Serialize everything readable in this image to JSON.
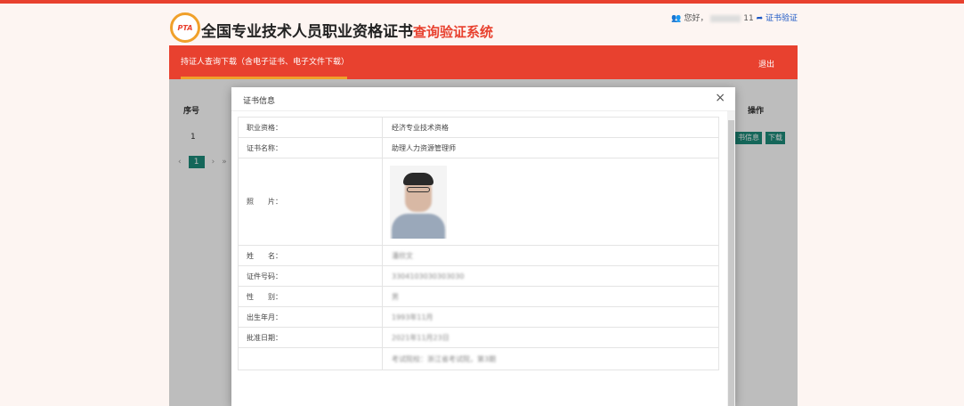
{
  "header": {
    "title_main": "全国专业技术人员职业资格证书",
    "title_sub": "查询验证系统",
    "logo_text": "PTA",
    "greeting": "您好，",
    "user_suffix": "11",
    "verify_link": "证书验证"
  },
  "nav": {
    "tab": "持证人查询下载（含电子证书、电子文件下载）",
    "logout": "退出"
  },
  "table": {
    "col_index": "序号",
    "col_op": "操作",
    "row_index": "1",
    "btn_info": "书信息",
    "btn_download": "下载"
  },
  "pager": {
    "prev": "‹",
    "page": "1",
    "next": "›",
    "last": "»"
  },
  "modal": {
    "title": "证书信息",
    "close": "×",
    "rows": {
      "qual_label": "职业资格：",
      "qual_value": "经济专业技术资格",
      "cert_name_label": "证书名称：",
      "cert_name_value": "助理人力资源管理师",
      "photo_label": "照　　片：",
      "name_label": "姓　　名：",
      "name_value": "潘欣文",
      "id_label": "证件号码：",
      "id_value": "3304103030303030",
      "gender_label": "性　　别：",
      "gender_value": "男",
      "birth_label": "出生年月：",
      "birth_value": "1993年11月",
      "approve_label": "批准日期：",
      "approve_value": "2021年11月23日",
      "note_value": "考试院校：浙江省考试院，第3期"
    }
  }
}
